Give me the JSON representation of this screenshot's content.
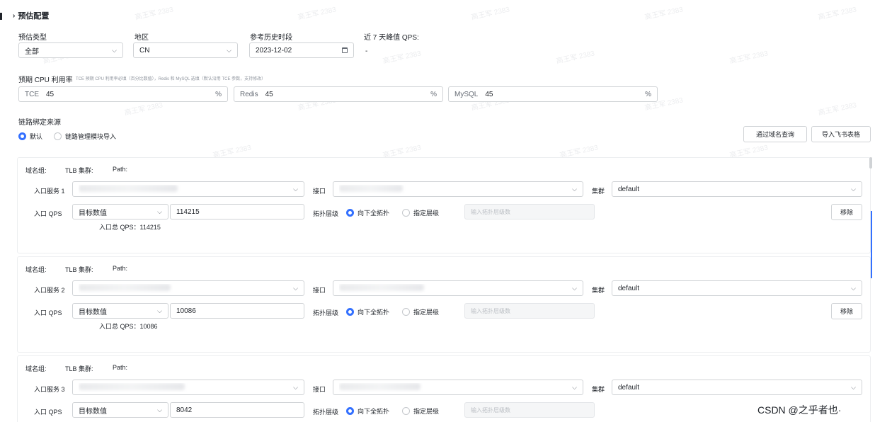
{
  "section": {
    "title": "预估配置"
  },
  "top": {
    "estimate_type": {
      "label": "预估类型",
      "value": "全部"
    },
    "region": {
      "label": "地区",
      "value": "CN"
    },
    "history": {
      "label": "参考历史时段",
      "value": "2023-12-02"
    },
    "peak": {
      "label": "近 7 天峰值 QPS:",
      "value": "-"
    }
  },
  "cpu": {
    "label": "预期 CPU 利用率",
    "hint": "TCE 预期 CPU 利用率必填（百分比数值），Redis 和 MySQL 选填（默认沿用 TCE 参数，支持修改）",
    "tce": {
      "prefix": "TCE",
      "value": "45",
      "suffix": "%"
    },
    "redis": {
      "prefix": "Redis",
      "value": "45",
      "suffix": "%"
    },
    "mysql": {
      "prefix": "MySQL",
      "value": "45",
      "suffix": "%"
    }
  },
  "source": {
    "label": "链路绑定来源",
    "opt_default": "默认",
    "opt_import": "链路管理模块导入",
    "btn_domain_query": "通过域名查询",
    "btn_import_sheet": "导入飞书表格"
  },
  "groups": [
    {
      "domain": "域名组:",
      "tlb": "TLB 集群:",
      "path": "Path:",
      "entry_label": "入口服务 1",
      "port_label": "接口",
      "cluster_label": "集群",
      "cluster_value": "default",
      "qps_label": "入口 QPS",
      "qps_mode": "目标数值",
      "qps_value": "114215",
      "topo_label": "拓扑层级",
      "topo_all": "向下全拓扑",
      "topo_specific": "指定层级",
      "topo_placeholder": "输入拓扑层级数",
      "remove": "移除",
      "total": "入口总 QPS：114215"
    },
    {
      "domain": "域名组:",
      "tlb": "TLB 集群:",
      "path": "Path:",
      "entry_label": "入口服务 2",
      "port_label": "接口",
      "cluster_label": "集群",
      "cluster_value": "default",
      "qps_label": "入口 QPS",
      "qps_mode": "目标数值",
      "qps_value": "10086",
      "topo_label": "拓扑层级",
      "topo_all": "向下全拓扑",
      "topo_specific": "指定层级",
      "topo_placeholder": "输入拓扑层级数",
      "remove": "移除",
      "total": "入口总 QPS：10086"
    },
    {
      "domain": "域名组:",
      "tlb": "TLB 集群:",
      "path": "Path:",
      "entry_label": "入口服务 3",
      "port_label": "接口",
      "cluster_label": "集群",
      "cluster_value": "default",
      "qps_label": "入口 QPS",
      "qps_mode": "目标数值",
      "qps_value": "8042",
      "topo_label": "拓扑层级",
      "topo_all": "向下全拓扑",
      "topo_specific": "指定层级",
      "topo_placeholder": "输入拓扑层级数"
    }
  ],
  "watermark": "高王军 2383",
  "footer_mark": "CSDN @之乎者也·",
  "colors": {
    "accent": "#3370ff",
    "border": "#d0d3d6",
    "text": "#1f2329",
    "muted": "#8f959e"
  },
  "icons": {
    "calendar": "calendar-icon",
    "chevron": "chevron-down-icon"
  }
}
